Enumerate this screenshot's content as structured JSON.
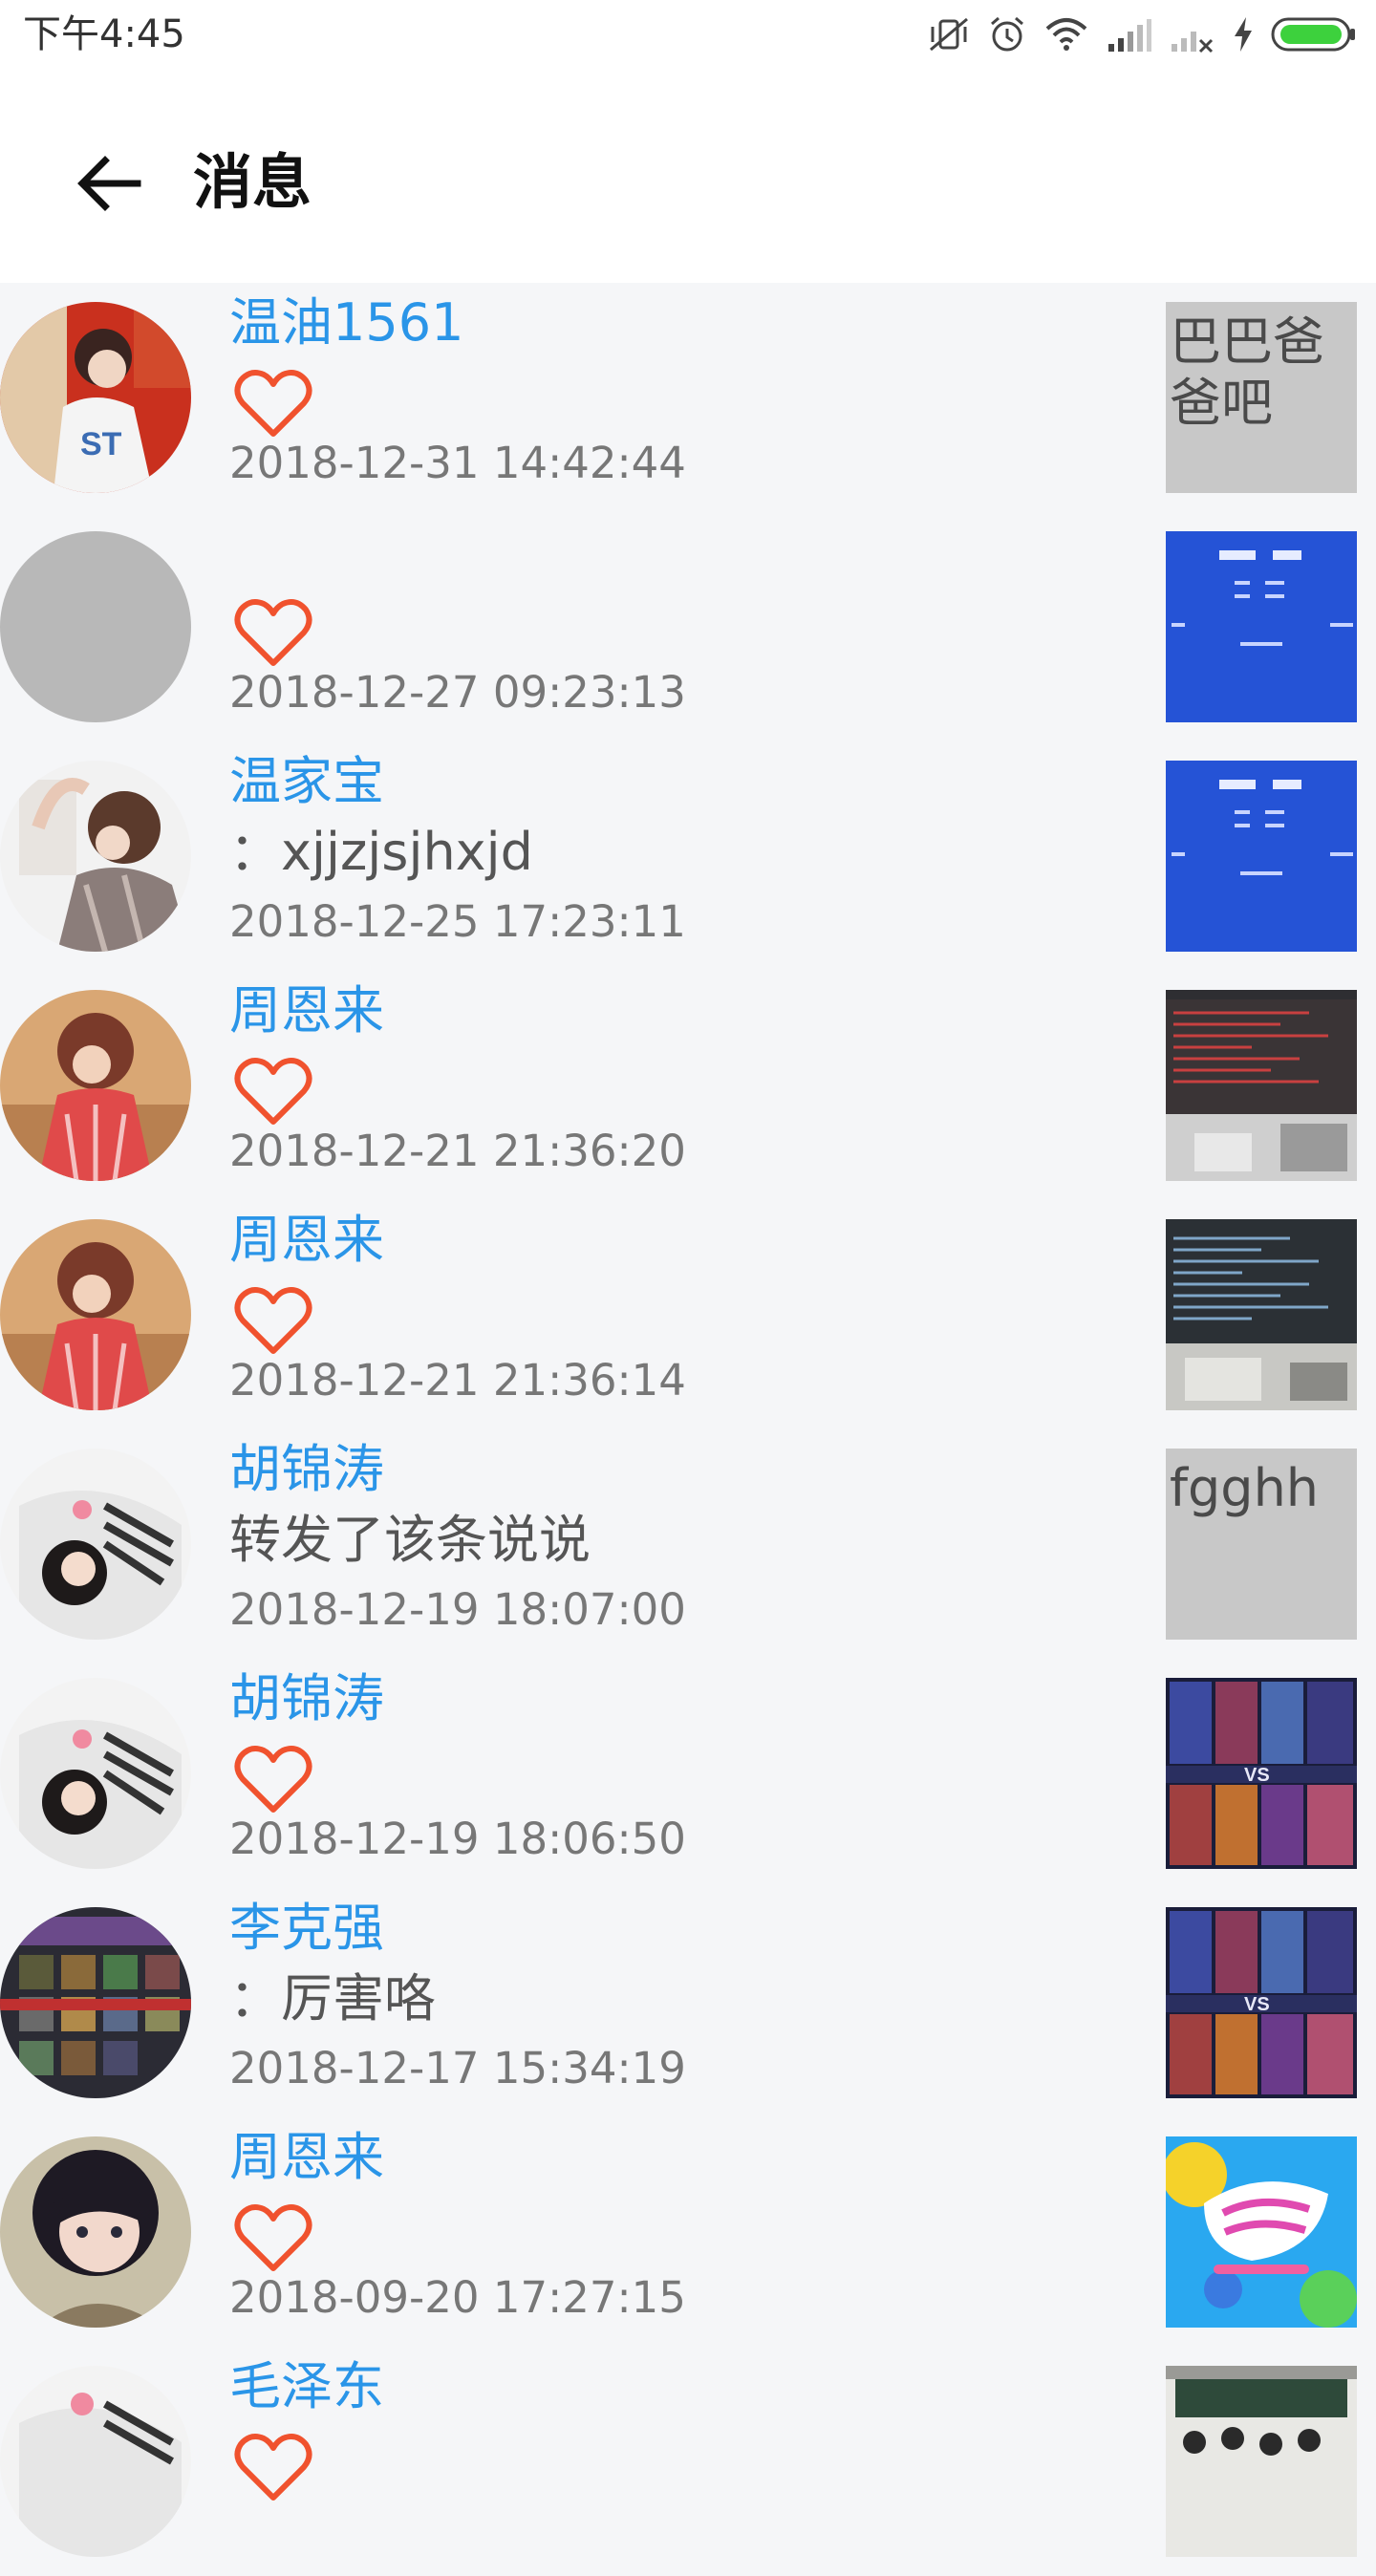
{
  "status_bar": {
    "time": "下午4:45",
    "icons": [
      "mute-vibrate-icon",
      "alarm-icon",
      "wifi-icon",
      "signal-icon",
      "signal-no-sim-icon",
      "charging-icon",
      "battery-icon"
    ],
    "battery_color": "#3dd13d"
  },
  "app_bar": {
    "back_icon": "arrow-left-icon",
    "title": "消息"
  },
  "colors": {
    "username": "#2a95e8",
    "heart": "#f0522e",
    "timestamp": "#777777",
    "background": "#f5f6f8"
  },
  "messages": [
    {
      "username": "温油1561",
      "type": "like",
      "content": "",
      "time": "2018-12-31 14:42:44",
      "thumb_type": "text",
      "thumb_text": "巴巴爸爸吧"
    },
    {
      "username": "",
      "type": "like",
      "content": "",
      "time": "2018-12-27 09:23:13",
      "thumb_type": "weather-screenshot",
      "thumb_text": ""
    },
    {
      "username": "温家宝",
      "type": "comment",
      "content": "：xjjzjsjhxjd",
      "time": "2018-12-25 17:23:11",
      "thumb_type": "weather-screenshot",
      "thumb_text": ""
    },
    {
      "username": "周恩来",
      "type": "like",
      "content": "",
      "time": "2018-12-21 21:36:20",
      "thumb_type": "code-photo-red",
      "thumb_text": ""
    },
    {
      "username": "周恩来",
      "type": "like",
      "content": "",
      "time": "2018-12-21 21:36:14",
      "thumb_type": "code-photo-blue",
      "thumb_text": ""
    },
    {
      "username": "胡锦涛",
      "type": "repost",
      "content": "转发了该条说说",
      "time": "2018-12-19 18:07:00",
      "thumb_type": "text",
      "thumb_text": "fgghh"
    },
    {
      "username": "胡锦涛",
      "type": "like",
      "content": "",
      "time": "2018-12-19 18:06:50",
      "thumb_type": "game-vs",
      "thumb_text": ""
    },
    {
      "username": "李克强",
      "type": "comment",
      "content": "：厉害咯",
      "time": "2018-12-17 15:34:19",
      "thumb_type": "game-vs",
      "thumb_text": ""
    },
    {
      "username": "周恩来",
      "type": "like",
      "content": "",
      "time": "2018-09-20 17:27:15",
      "thumb_type": "promo-banner",
      "thumb_text": ""
    },
    {
      "username": "毛泽东",
      "type": "like",
      "content": "",
      "time": "",
      "thumb_type": "classroom-photo",
      "thumb_text": ""
    }
  ]
}
